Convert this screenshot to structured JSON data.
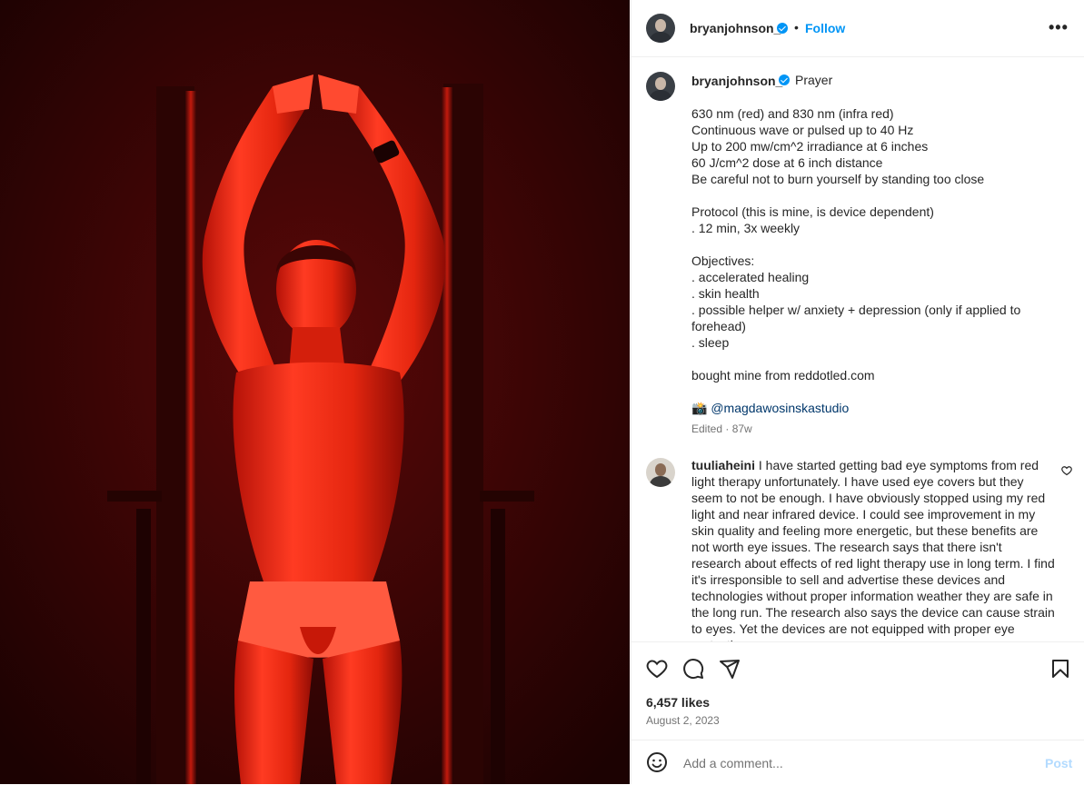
{
  "header": {
    "username": "bryanjohnson_",
    "separator": "•",
    "follow_label": "Follow",
    "more_label": "•••"
  },
  "caption": {
    "username": "bryanjohnson_",
    "title": "Prayer",
    "lines": [
      "630 nm (red) and 830 nm (infra red)",
      "Continuous wave or pulsed up to 40 Hz",
      "Up to 200 mw/cm^2 irradiance at 6 inches",
      "60 J/cm^2 dose at 6 inch distance",
      "Be careful not to burn yourself by standing too close",
      "",
      "Protocol (this is mine, is device dependent)",
      ". 12 min, 3x weekly",
      "",
      "Objectives:",
      ". accelerated healing",
      ". skin health",
      ". possible helper w/ anxiety + depression (only if applied to",
      "forehead)",
      ". sleep",
      "",
      "bought mine from reddotled.com",
      ""
    ],
    "credit_emoji": "📸",
    "credit_mention": "@magdawosinskastudio",
    "meta": "Edited · 87w"
  },
  "comment": {
    "username": "tuuliaheini",
    "text": "I have started getting bad eye symptoms from red light therapy unfortunately. I have used eye covers but they seem to not be enough. I have obviously stopped using my red light and near infrared device. I could see improvement in my skin quality and feeling more energetic, but these benefits are not worth eye issues. The research says that there isn't research about effects of red light therapy use in long term. I find it's irresponsible to sell and advertise these devices and technologies without proper information weather they are safe in the long run. The research also says the device can cause strain to eyes. Yet the devices are not equipped with proper eye protection."
  },
  "stats": {
    "likes": "6,457 likes",
    "date": "August 2, 2023"
  },
  "add_comment": {
    "placeholder": "Add a comment...",
    "post_label": "Post"
  },
  "colors": {
    "link": "#0095f6",
    "mention": "#00376b",
    "post_disabled": "#b3dbff",
    "photo_bg": "#2a0303"
  },
  "icons": {
    "like": "heart-icon",
    "comment": "comment-icon",
    "share": "share-icon",
    "save": "bookmark-icon",
    "emoji": "emoji-icon",
    "more": "more-options-icon"
  }
}
